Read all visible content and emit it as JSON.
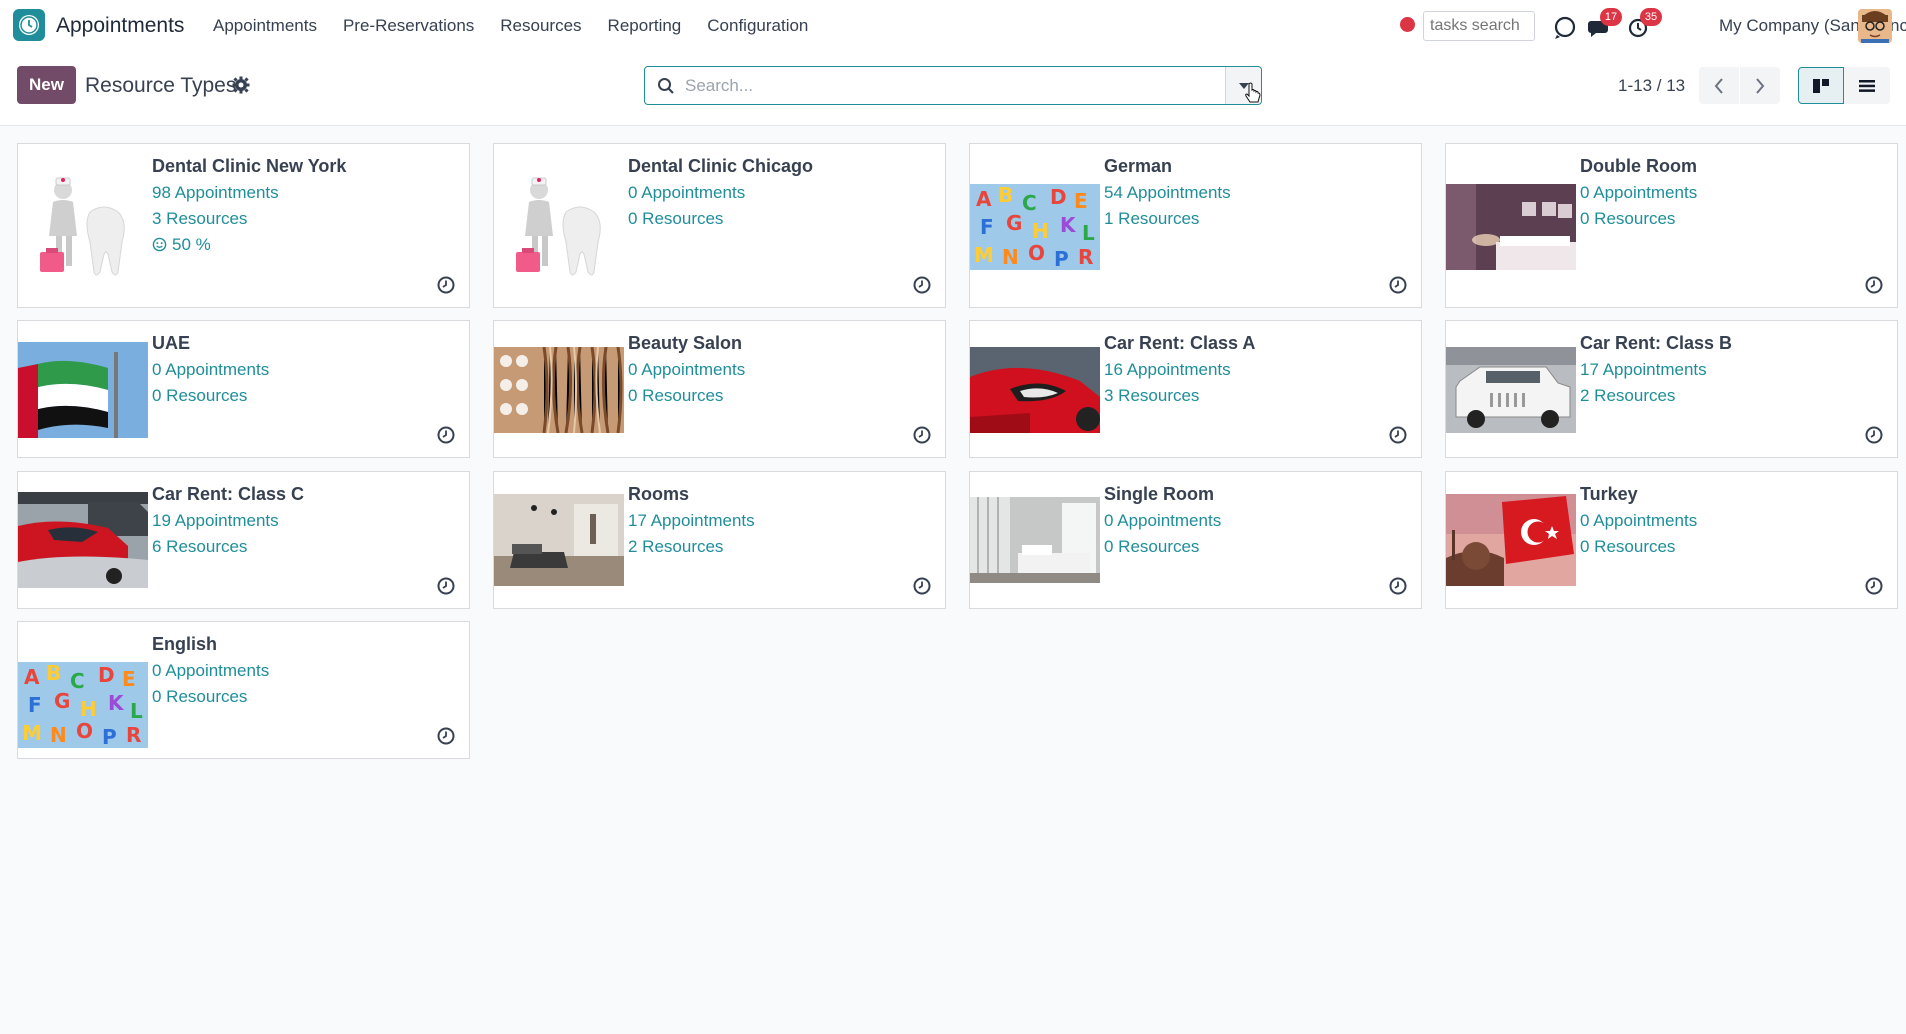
{
  "app": {
    "name": "Appointments"
  },
  "menu": [
    "Appointments",
    "Pre-Reservations",
    "Resources",
    "Reporting",
    "Configuration"
  ],
  "topbar": {
    "tasks_search_placeholder": "tasks search",
    "messages_badge": "17",
    "activities_badge": "35",
    "company": "My Company (San Francisco)"
  },
  "control": {
    "new_label": "New",
    "title": "Resource Types",
    "search_placeholder": "Search...",
    "pager": "1-13 / 13"
  },
  "colors": {
    "brand": "#714b67",
    "accent": "#1f8e9a",
    "danger": "#dc3545"
  },
  "cards": [
    {
      "title": "Dental Clinic New York",
      "appointments": "98 Appointments",
      "resources": "3 Resources",
      "rate": "50 %",
      "image": "dental-illustration"
    },
    {
      "title": "Dental Clinic Chicago",
      "appointments": "0 Appointments",
      "resources": "0 Resources",
      "image": "dental-illustration"
    },
    {
      "title": "German",
      "appointments": "54 Appointments",
      "resources": "1 Resources",
      "image": "letters"
    },
    {
      "title": "Double Room",
      "appointments": "0 Appointments",
      "resources": "0 Resources",
      "image": "bedroom"
    },
    {
      "title": "UAE",
      "appointments": "0 Appointments",
      "resources": "0 Resources",
      "image": "uae-flag"
    },
    {
      "title": "Beauty Salon",
      "appointments": "0 Appointments",
      "resources": "0 Resources",
      "image": "salon"
    },
    {
      "title": "Car Rent: Class A",
      "appointments": "16 Appointments",
      "resources": "3 Resources",
      "image": "red-car"
    },
    {
      "title": "Car Rent: Class B",
      "appointments": "17 Appointments",
      "resources": "2 Resources",
      "image": "white-suv"
    },
    {
      "title": "Car Rent: Class C",
      "appointments": "19 Appointments",
      "resources": "6 Resources",
      "image": "cars-lot"
    },
    {
      "title": "Rooms",
      "appointments": "17 Appointments",
      "resources": "2 Resources",
      "image": "living-room"
    },
    {
      "title": "Single Room",
      "appointments": "0 Appointments",
      "resources": "0 Resources",
      "image": "single-room"
    },
    {
      "title": "Turkey",
      "appointments": "0 Appointments",
      "resources": "0 Resources",
      "image": "turkey-flag"
    },
    {
      "title": "English",
      "appointments": "0 Appointments",
      "resources": "0 Resources",
      "image": "letters"
    }
  ]
}
